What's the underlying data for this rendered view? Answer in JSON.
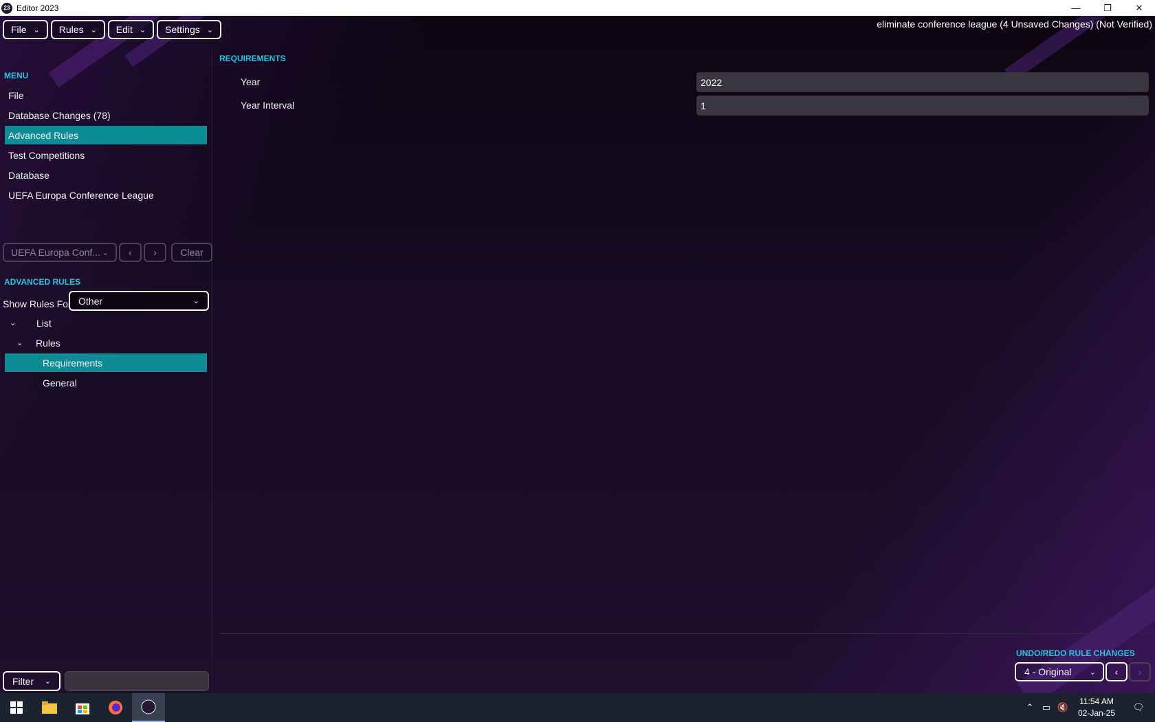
{
  "window": {
    "title": "Editor 2023",
    "app_icon_text": "23",
    "controls": {
      "minimize": "—",
      "restore": "❐",
      "close": "✕"
    }
  },
  "menubar": {
    "items": [
      {
        "label": "File"
      },
      {
        "label": "Rules"
      },
      {
        "label": "Edit"
      },
      {
        "label": "Settings"
      }
    ]
  },
  "file_status": "eliminate conference league (4 Unsaved Changes) (Not Verified)",
  "left_menu": {
    "title": "MENU",
    "items": [
      {
        "label": "File",
        "active": false
      },
      {
        "label": "Database Changes (78)",
        "active": false
      },
      {
        "label": "Advanced Rules",
        "active": true
      },
      {
        "label": "Test Competitions",
        "active": false
      },
      {
        "label": "Database",
        "active": false
      },
      {
        "label": "UEFA Europa Conference League",
        "active": false
      }
    ]
  },
  "entity_controls": {
    "selected": "UEFA Europa Conf...",
    "prev": "‹",
    "next": "›",
    "clear_label": "Clear"
  },
  "advanced_rules": {
    "title": "ADVANCED RULES",
    "show_rules_for_label": "Show Rules For",
    "show_rules_for_value": "Other",
    "tree": [
      {
        "label": "List",
        "level": 0,
        "expanded": true,
        "active": false
      },
      {
        "label": "Rules",
        "level": 1,
        "expanded": true,
        "active": false
      },
      {
        "label": "Requirements",
        "level": 2,
        "active": true
      },
      {
        "label": "General",
        "level": 2,
        "active": false
      }
    ]
  },
  "filter": {
    "label": "Filter",
    "value": ""
  },
  "requirements": {
    "title": "REQUIREMENTS",
    "fields": [
      {
        "label": "Year",
        "value": "2022"
      },
      {
        "label": "Year Interval",
        "value": "1"
      }
    ]
  },
  "undo_redo": {
    "title": "UNDO/REDO RULE CHANGES",
    "selected": "4 - Original",
    "prev": "‹",
    "next": "›"
  },
  "taskbar": {
    "clock_time": "11:54 AM",
    "clock_date": "02-Jan-25",
    "apps": [
      "start-icon",
      "file-explorer-icon",
      "store-icon",
      "firefox-icon",
      "editor-icon"
    ]
  },
  "colors": {
    "accent": "#27c6df",
    "selected_row": "#0e8c95",
    "background": "#140b1e"
  }
}
